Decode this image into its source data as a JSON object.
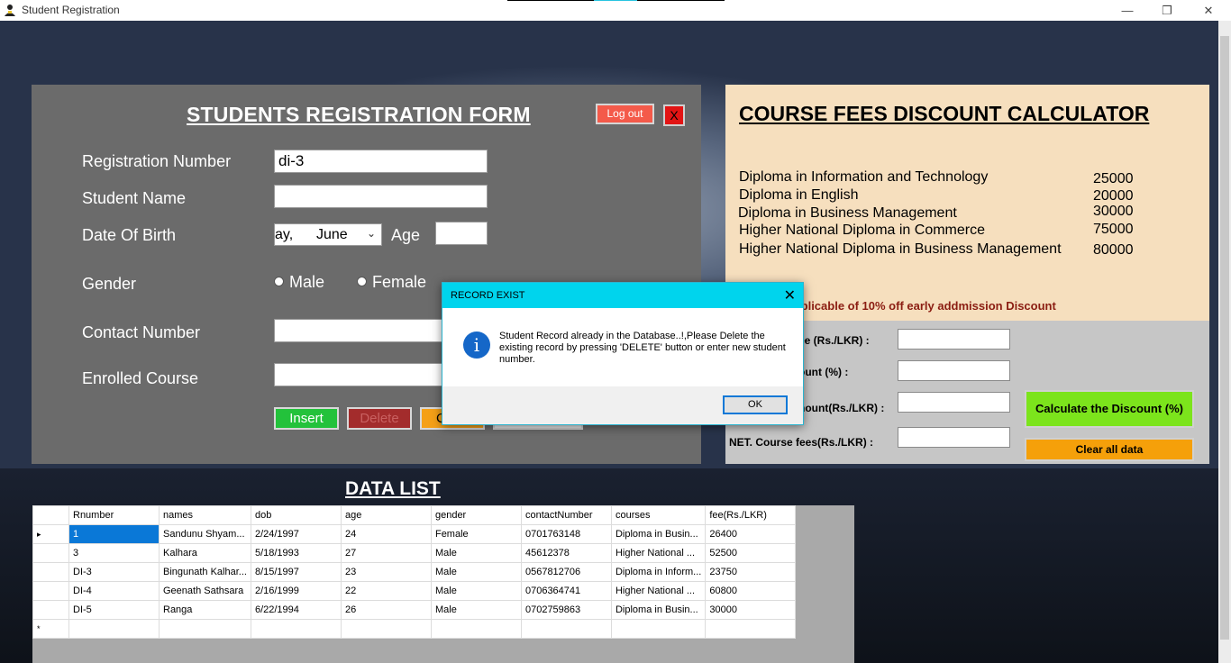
{
  "window": {
    "title": "Student Registration",
    "minimize_icon": "minimize-icon",
    "restore_icon": "restore-icon",
    "close_icon": "close-icon"
  },
  "registration": {
    "title": "STUDENTS REGISTRATION FORM",
    "logout_label": "Log out",
    "close_label": "X",
    "fields": {
      "reg_number_label": "Registration Number",
      "reg_number_value": "di-3",
      "name_label": "Student Name",
      "name_value": "",
      "dob_label": "Date Of Birth",
      "dob_day": "ay,",
      "dob_month": "June",
      "age_label": "Age",
      "age_value": "",
      "gender_label": "Gender",
      "gender_male": "Male",
      "gender_female": "Female",
      "contact_label": "Contact Number",
      "contact_value": "",
      "course_label": "Enrolled Course",
      "course_value": ""
    },
    "buttons": {
      "insert": "Insert",
      "delete": "Delete",
      "clear": "C"
    }
  },
  "calculator": {
    "title": "COURSE FEES DISCOUNT CALCULATOR",
    "courses": [
      {
        "name": "Diploma in Information and Technology",
        "fee": "25000"
      },
      {
        "name": "Diploma in English",
        "fee": "20000"
      },
      {
        "name": "Diploma in Business Management",
        "fee": "30000"
      },
      {
        "name": "Higher National Diploma in Commerce",
        "fee": "75000"
      },
      {
        "name": "Higher National Diploma in Business Management",
        "fee": "80000"
      }
    ],
    "note": "ourse is applicable of 10% off early addmission Discount",
    "labels": {
      "fee": "ee (Rs./LKR) :",
      "discount_pct": "ount (%) :",
      "discount_amount": "nount(Rs./LKR) :",
      "net_fee": "NET. Course fees(Rs./LKR) :"
    },
    "calculate_label": "Calculate the Discount (%)",
    "clear_all_label": "Clear all data"
  },
  "data_list": {
    "title": "DATA LIST",
    "columns": [
      "Rnumber",
      "names",
      "dob",
      "age",
      "gender",
      "contactNumber",
      "courses",
      "fee(Rs./LKR)"
    ],
    "rows": [
      [
        "1",
        "Sandunu Shyam...",
        "2/24/1997",
        "24",
        "Female",
        "0701763148",
        "Diploma in Busin...",
        "26400"
      ],
      [
        "3",
        "Kalhara",
        "5/18/1993",
        "27",
        "Male",
        "45612378",
        "Higher National ...",
        "52500"
      ],
      [
        "DI-3",
        "Bingunath Kalhar...",
        "8/15/1997",
        "23",
        "Male",
        "0567812706",
        "Diploma in Inform...",
        "23750"
      ],
      [
        "DI-4",
        "Geenath Sathsara",
        "2/16/1999",
        "22",
        "Male",
        "0706364741",
        "Higher National ...",
        "60800"
      ],
      [
        "DI-5",
        "Ranga",
        "6/22/1994",
        "26",
        "Male",
        "0702759863",
        "Diploma in Busin...",
        "30000"
      ]
    ],
    "current_marker": "▸",
    "new_row_marker": "*"
  },
  "dialog": {
    "title": "RECORD EXIST",
    "close_label": "✕",
    "message": "Student Record already in the Database..!,Please Delete the existing record by pressing 'DELETE' button or enter new student number.",
    "ok_label": "OK",
    "icon": "info-icon"
  },
  "colors": {
    "accent": "#00d4ed",
    "insert": "#23c23b",
    "delete": "#a32c2c",
    "calc": "#7ce41c",
    "clear": "#f5a00a",
    "logout": "#f45a4a"
  }
}
